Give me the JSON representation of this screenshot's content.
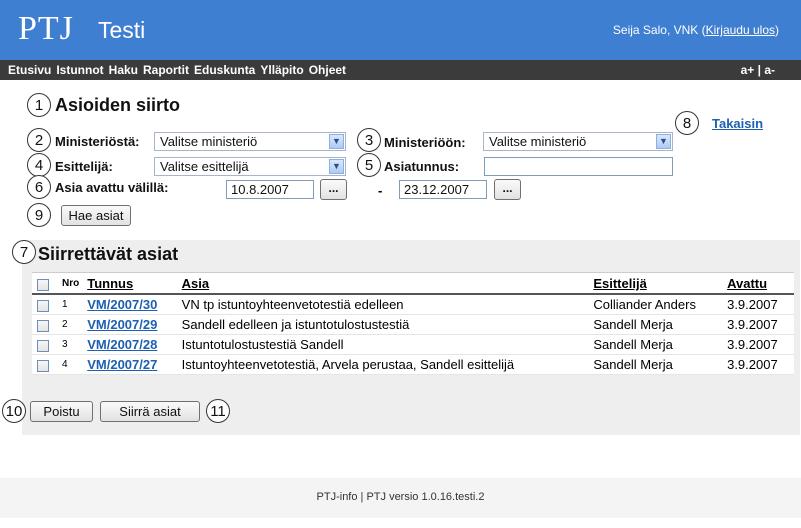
{
  "header": {
    "logo": "PTJ",
    "app_title": "Testi",
    "user_text": "Seija Salo, VNK (",
    "logout_link": "Kirjaudu ulos",
    "user_text_close": ")"
  },
  "nav": {
    "items": [
      "Etusivu",
      "Istunnot",
      "Haku",
      "Raportit",
      "Eduskunta",
      "Ylläpito",
      "Ohjeet"
    ],
    "size_ctrl": "a+ | a-"
  },
  "annotations": [
    "1",
    "2",
    "3",
    "4",
    "5",
    "6",
    "7",
    "8",
    "9",
    "10",
    "11"
  ],
  "page": {
    "title": "Asioiden siirto",
    "back_link": "Takaisin"
  },
  "form": {
    "from_ministry_label": "Ministeriöstä:",
    "from_ministry_value": "Valitse ministeriö",
    "to_ministry_label": "Ministeriöön:",
    "to_ministry_value": "Valitse ministeriö",
    "presenter_label": "Esittelijä:",
    "presenter_value": "Valitse esittelijä",
    "case_id_label": "Asiatunnus:",
    "case_id_value": "",
    "opened_between_label": "Asia avattu välillä:",
    "date_from": "10.8.2007",
    "date_separator": "-",
    "date_to": "23.12.2007",
    "date_picker_label": "...",
    "search_button": "Hae asiat"
  },
  "results": {
    "title": "Siirrettävät asiat",
    "columns": [
      "Nro",
      "Tunnus",
      "Asia",
      "Esittelijä",
      "Avattu"
    ],
    "rows": [
      {
        "nro": "1",
        "tunnus": "VM/2007/30",
        "asia": "VN tp istuntoyhteenvetotestiä edelleen",
        "esittelija": "Colliander Anders",
        "avattu": "3.9.2007"
      },
      {
        "nro": "2",
        "tunnus": "VM/2007/29",
        "asia": "Sandell edelleen ja istuntotulostustestiä",
        "esittelija": "Sandell Merja",
        "avattu": "3.9.2007"
      },
      {
        "nro": "3",
        "tunnus": "VM/2007/28",
        "asia": "Istuntotulostustestiä Sandell",
        "esittelija": "Sandell Merja",
        "avattu": "3.9.2007"
      },
      {
        "nro": "4",
        "tunnus": "VM/2007/27",
        "asia": "Istuntoyhteenvetotestiä, Arvela perustaa, Sandell esittelijä",
        "esittelija": "Sandell Merja",
        "avattu": "3.9.2007"
      }
    ],
    "delete_button": "Poistu",
    "move_button": "Siirrä asiat"
  },
  "footer": {
    "text": "PTJ-info | PTJ versio 1.0.16.testi.2"
  }
}
